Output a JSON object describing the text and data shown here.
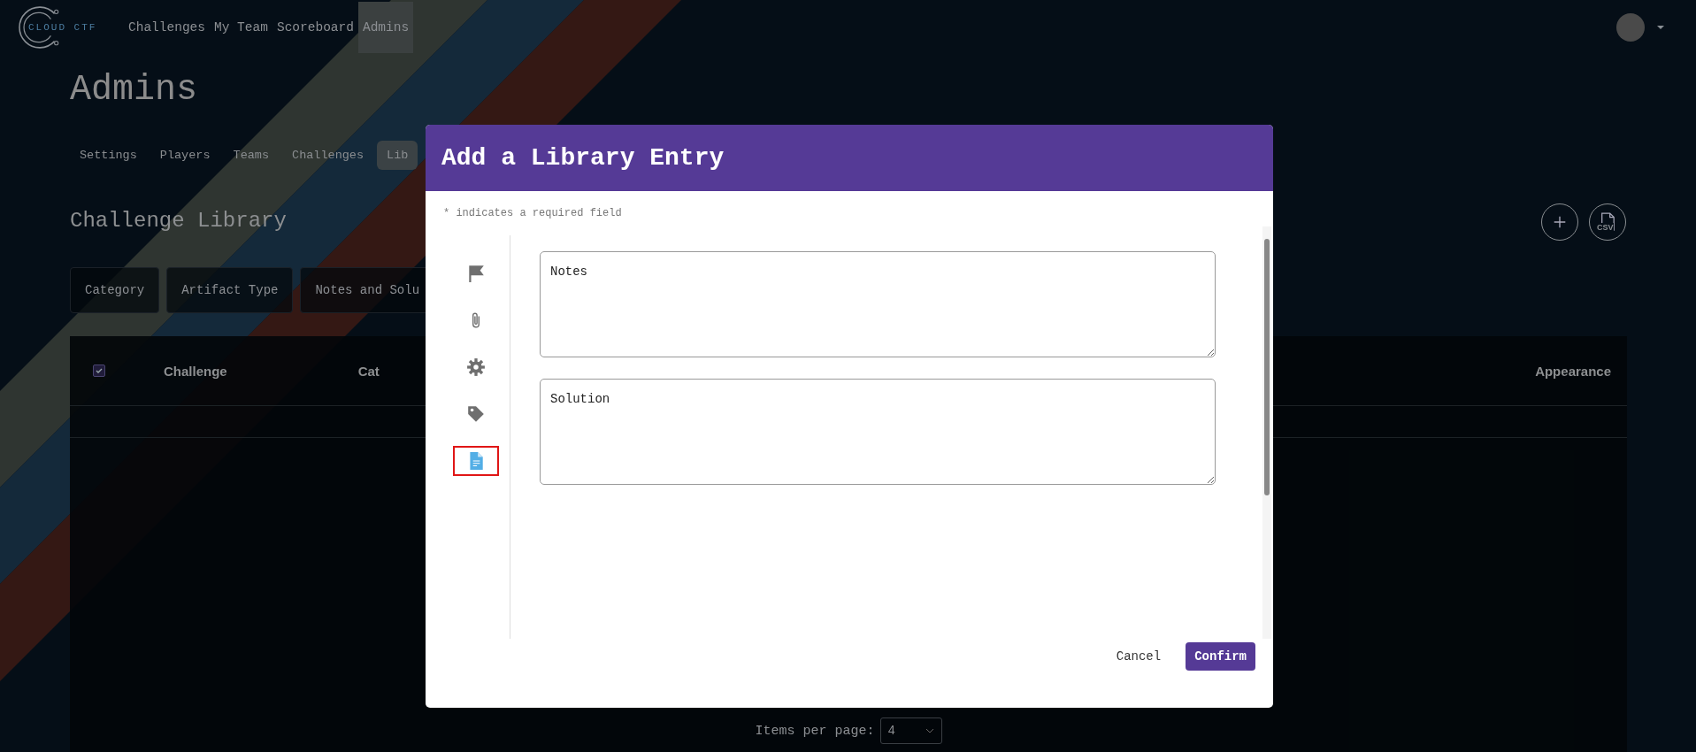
{
  "logo": {
    "text": "CLOUD CTF"
  },
  "nav": [
    {
      "label": "Challenges",
      "selected": false
    },
    {
      "label": "My Team",
      "selected": false
    },
    {
      "label": "Scoreboard",
      "selected": false
    },
    {
      "label": "Admins",
      "selected": true
    }
  ],
  "page_title": "Admins",
  "admin_tabs": [
    {
      "label": "Settings",
      "selected": false
    },
    {
      "label": "Players",
      "selected": false
    },
    {
      "label": "Teams",
      "selected": false
    },
    {
      "label": "Challenges",
      "selected": false
    },
    {
      "label": "Lib",
      "selected": true
    }
  ],
  "section_title": "Challenge Library",
  "csv_icon_label": "CSV",
  "filters": [
    "Category",
    "Artifact Type",
    "Notes and Solu"
  ],
  "table": {
    "select_all_checked": true,
    "columns": [
      "Challenge",
      "Cat",
      "Appearance"
    ]
  },
  "pagination": {
    "label": "Items per page:",
    "value": "4"
  },
  "modal": {
    "title": "Add a Library Entry",
    "required_note": "* indicates a required field",
    "steps": [
      {
        "kind": "flag",
        "selected": false
      },
      {
        "kind": "paperclip",
        "selected": false
      },
      {
        "kind": "gear",
        "selected": false
      },
      {
        "kind": "tag",
        "selected": false
      },
      {
        "kind": "document",
        "selected": true
      }
    ],
    "fields": [
      {
        "placeholder": "Notes"
      },
      {
        "placeholder": "Solution"
      }
    ],
    "buttons": [
      {
        "label": "Cancel",
        "kind": "text"
      },
      {
        "label": "Confirm",
        "kind": "primary"
      }
    ]
  }
}
